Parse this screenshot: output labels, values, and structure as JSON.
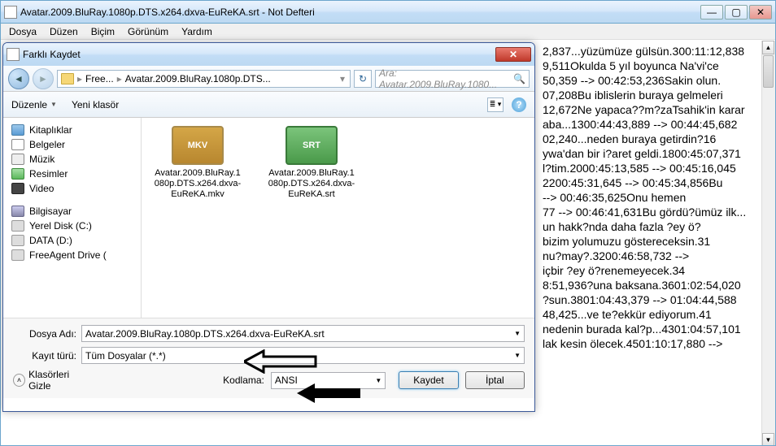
{
  "notepad": {
    "title": "Avatar.2009.BluRay.1080p.DTS.x264.dxva-EuReKA.srt - Not Defteri",
    "menu": [
      "Dosya",
      "Düzen",
      "Biçim",
      "Görünüm",
      "Yardım"
    ],
    "text": "2,837...yüzümüze gülsün.300:11:12,838\n9,511Okulda 5 yıl boyunca Na'vi'ce\n50,359 --> 00:42:53,236Sakin olun.\n07,208Bu iblislerin buraya gelmeleri\n12,672Ne yapaca??m?zaTsahik'in karar\naba...1300:44:43,889 --> 00:44:45,682\n02,240...neden buraya getirdin?16\nywa'dan bir i?aret geldi.1800:45:07,371\nl?tim.2000:45:13,585 --> 00:45:16,045\n2200:45:31,645 --> 00:45:34,856Bu\n--> 00:46:35,625Onu hemen\n77 --> 00:46:41,631Bu gördü?ümüz ilk...\nun hakk?nda daha fazla ?ey ö?\nbizim yolumuzu göstereceksin.31\nnu?may?.3200:46:58,732 -->\niçbir ?ey ö?renemeyecek.34\n8:51,936?una baksana.3601:02:54,020\n?sun.3801:04:43,379 --> 01:04:44,588\n48,425...ve te?ekkür ediyorum.41\nnedenin burada kal?p...4301:04:57,101\nlak kesin ölecek.4501:10:17,880 -->"
  },
  "dialog": {
    "title": "Farklı Kaydet",
    "breadcrumb": {
      "item1": "Free...",
      "item2": "Avatar.2009.BluRay.1080p.DTS...",
      "drop": "▸"
    },
    "searchPlaceholder": "Ara: Avatar.2009.BluRay.1080...",
    "toolbar": {
      "organize": "Düzenle",
      "newfolder": "Yeni klasör"
    },
    "sidebar": {
      "libs": "Kitaplıklar",
      "docs": "Belgeler",
      "music": "Müzik",
      "pics": "Resimler",
      "video": "Video",
      "computer": "Bilgisayar",
      "diskC": "Yerel Disk (C:)",
      "diskD": "DATA (D:)",
      "free": "FreeAgent Drive ("
    },
    "files": {
      "mkvLabel": "MKV",
      "mkvName": "Avatar.2009.BluRay.1080p.DTS.x264.dxva-EuReKA.mkv",
      "srtLabel": "SRT",
      "srtName": "Avatar.2009.BluRay.1080p.DTS.x264.dxva-EuReKA.srt"
    },
    "labels": {
      "filename": "Dosya Adı:",
      "filetype": "Kayıt türü:",
      "encoding": "Kodlama:",
      "hidefolders": "Klasörleri Gizle",
      "save": "Kaydet",
      "cancel": "İptal"
    },
    "values": {
      "filename": "Avatar.2009.BluRay.1080p.DTS.x264.dxva-EuReKA.srt",
      "filetype": "Tüm Dosyalar  (*.*)",
      "encoding": "ANSI"
    }
  }
}
